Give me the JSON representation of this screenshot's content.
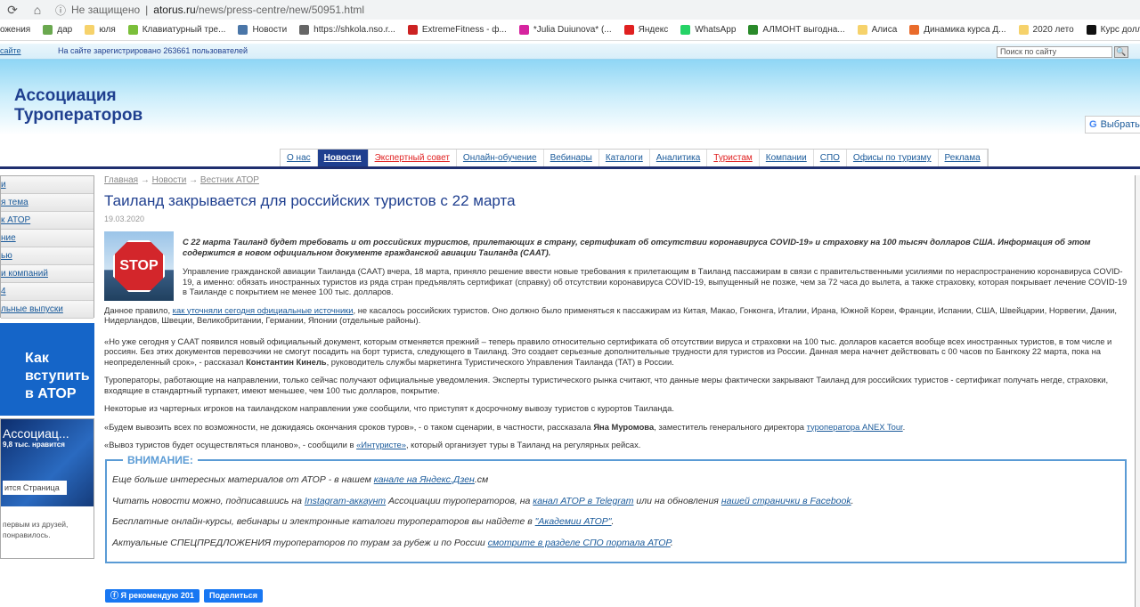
{
  "browser": {
    "security": "Не защищено",
    "url_host": "atorus.ru",
    "url_path": "/news/press-centre/new/50951.html"
  },
  "bookmarks": [
    "ожения",
    "дар",
    "юля",
    "Клавиатурный тре...",
    "Новости",
    "https://shkola.nso.r...",
    "ExtremeFitness - ф...",
    "*Julia Duiunova* (...",
    "Яндекс",
    "WhatsApp",
    "АЛМОНТ выгодна...",
    "Алиса",
    "Динамика курса Д...",
    "2020 лето",
    "Курс доллара"
  ],
  "bookmark_colors": [
    "#ffffff",
    "#6aa84f",
    "#f6d26b",
    "#7bbf3a",
    "#4a76a8",
    "#666666",
    "#cc2222",
    "#d6249f",
    "#e02020",
    "#25d366",
    "#2a8a2a",
    "#f6d26b",
    "#e96b2b",
    "#f6d26b",
    "#111111"
  ],
  "topbar": {
    "left_link": "сайте",
    "registered": "На сайте зарегистрировано 263661 пользователей",
    "search_placeholder": "Поиск по сайту"
  },
  "logo": {
    "line1": "Ассоциация",
    "line2": "Туроператоров"
  },
  "translate": "Выбрать",
  "nav": [
    {
      "label": "О нас"
    },
    {
      "label": "Новости",
      "active": true
    },
    {
      "label": "Экспертный совет",
      "red": true
    },
    {
      "label": "Онлайн-обучение"
    },
    {
      "label": "Вебинары"
    },
    {
      "label": "Каталоги"
    },
    {
      "label": "Аналитика"
    },
    {
      "label": "Туристам",
      "red": true
    },
    {
      "label": "Компании"
    },
    {
      "label": "СПО"
    },
    {
      "label": "Офисы по туризму"
    },
    {
      "label": "Реклама"
    }
  ],
  "sidebar": [
    "и",
    "я тема",
    "к АТОР",
    "ние",
    "ью",
    "и компаний",
    "4",
    "льные выпуски"
  ],
  "banner": {
    "l1": "Как",
    "l2": "вступить",
    "l3": "в АТОР"
  },
  "fb_widget": {
    "name": "Ассоциац...",
    "likes": "9,8 тыс. нравится",
    "button": "ится Страница",
    "friends": "первым из друзей, понравилось."
  },
  "article": {
    "breadcrumb": [
      "Главная",
      "Новости",
      "Вестник АТОР"
    ],
    "title": "Таиланд закрывается для российских туристов с 22 марта",
    "date": "19.03.2020",
    "image_text": "STOP",
    "lead": "С 22 марта Таиланд будет требовать и от российских туристов, прилетающих в страну, сертификат об отсутствии коронавируса COVID-19» и страховку на 100 тысяч долларов США. Информация об этом содержится в новом официальном документе гражданской авиации Таиланда (CAAT).",
    "p1": "Управление гражданской авиации Таиланда (CAAT) вчера, 18 марта, приняло решение ввести новые требования к прилетающим в Таиланд пассажирам в связи с правительственными усилиями по нераспространению коронавируса COVID-19, а именно: обязать иностранных туристов из ряда стран предъявлять сертификат (справку) об отсутствии коронавируса COVID-19, выпущенный не позже, чем за 72 часа до вылета, а также страховку, которая покрывает лечение COVID-19 в Таиланде с покрытием не менее 100 тыс. долларов.",
    "p2_a": "Данное правило, ",
    "p2_link": "как уточняли сегодня официальные источники",
    "p2_b": ", не касалось российских туристов. Оно должно было применяться к пассажирам из Китая, Макао, Гонконга, Италии, Ирана, Южной Кореи, Франции, Испании, США, Швейцарии, Норвегии, Дании, Нидерландов, Швеции, Великобритании, Германии, Японии (отдельные районы).",
    "p3_a": "«Но уже сегодня у CAAT появился новый официальный документ, которым отменяется прежний – теперь правило относительно сертификата об отсутствии вируса и страховки на 100 тыс. долларов касается вообще всех иностранных туристов, в том числе и россиян. Без этих документов перевозчики не смогут посадить на борт туриста, следующего в Таиланд. Это создает серьезные дополнительные трудности для туристов из России. Данная мера начнет действовать с 00 часов по Бангкоку 22 марта, пока на неопределенный срок», - рассказал ",
    "p3_name": "Константин Кинель",
    "p3_b": ", руководитель службы маркетинга Туристического Управления Таиланда (TAT) в России.",
    "p4": "Туроператоры, работающие на направлении, только сейчас получают официальные уведомления. Эксперты туристического рынка считают, что данные меры фактически закрывают Таиланд для российских туристов - сертификат получать негде, страховки, входящие в стандартный турпакет, имеют меньшее, чем 100 тыс долларов, покрытие.",
    "p5": "Некоторые из чартерных игроков на таиландском направлении уже сообщили, что приступят к досрочному вывозу туристов с курортов Таиланда.",
    "p6_a": "«Будем вывозить всех по возможности, не дожидаясь окончания сроков туров», - о таком сценарии, в частности, рассказала ",
    "p6_name": "Яна Муромова",
    "p6_b": ", заместитель генерального директора ",
    "p6_link": "туроператора ANEX Tour",
    "p7_a": "«Вывоз туристов будет осуществляться планово», - сообщили в ",
    "p7_link": "«Интуристе»",
    "p7_b": ", который организует туры в Таиланд на регулярных рейсах."
  },
  "attention": {
    "legend": "ВНИМАНИЕ:",
    "l1_a": "Еще больше интересных материалов от АТОР - в нашем ",
    "l1_link": "канале на Яндекс.Дзен",
    "l1_b": ".см",
    "l2_a": "Читать новости можно, подписавшись на ",
    "l2_link1": "Instagram-аккаунт",
    "l2_b": " Ассоциации туроператоров, на ",
    "l2_link2": "канал АТОР в Telegram",
    "l2_c": " или на обновления ",
    "l2_link3": "нашей странички в Facebook",
    "l3_a": "Бесплатные онлайн-курсы, вебинары и электронные каталоги туроператоров вы найдете в ",
    "l3_link": "\"Академии АТОР\"",
    "l4_a": "Актуальные СПЕЦПРЕДЛОЖЕНИЯ туроператоров по турам за рубеж и по России ",
    "l4_link": "смотрите в разделе СПО портала АТОР"
  },
  "social": {
    "recommend": "Я рекомендую 201",
    "share": "Поделиться"
  }
}
